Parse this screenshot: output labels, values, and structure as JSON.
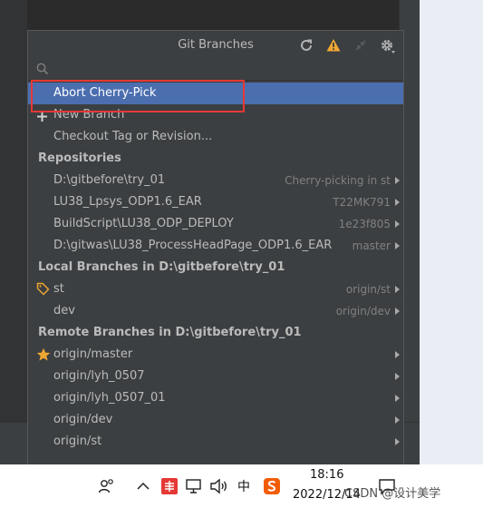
{
  "popup": {
    "title": "Git Branches",
    "search": {
      "value": "",
      "placeholder": ""
    },
    "items": {
      "abort_cherry_pick": "Abort Cherry-Pick",
      "new_branch": "New Branch",
      "checkout_tag": "Checkout Tag or Revision..."
    },
    "repositories": {
      "header": "Repositories",
      "rows": [
        {
          "name": "D:\\gitbefore\\try_01",
          "hint": "Cherry-picking in st"
        },
        {
          "name": "LU38_Lpsys_ODP1.6_EAR",
          "hint": "T22MK791"
        },
        {
          "name": "BuildScript\\LU38_ODP_DEPLOY",
          "hint": "1e23f805"
        },
        {
          "name": "D:\\gitwas\\LU38_ProcessHeadPage_ODP1.6_EAR",
          "hint": "master"
        }
      ]
    },
    "local_branches": {
      "header": "Local Branches in D:\\gitbefore\\try_01",
      "rows": [
        {
          "name": "st",
          "hint": "origin/st"
        },
        {
          "name": "dev",
          "hint": "origin/dev"
        }
      ]
    },
    "remote_branches": {
      "header": "Remote Branches in D:\\gitbefore\\try_01",
      "rows": [
        {
          "name": "origin/master"
        },
        {
          "name": "origin/lyh_0507"
        },
        {
          "name": "origin/lyh_0507_01"
        },
        {
          "name": "origin/dev"
        },
        {
          "name": "origin/st"
        }
      ]
    }
  },
  "taskbar": {
    "time": "18:16",
    "date": "2022/12/14",
    "ime": "中",
    "watermark": "CSDN @设计美学"
  },
  "colors": {
    "selection": "#4b6eaf",
    "warning": "#f0a732",
    "favorite": "#f0a732",
    "highlight_box": "#e53935"
  },
  "icons": [
    "refresh-icon",
    "warning-icon",
    "collapse-icon",
    "gear-icon",
    "search-icon",
    "plus-icon",
    "tag-icon",
    "star-icon"
  ]
}
